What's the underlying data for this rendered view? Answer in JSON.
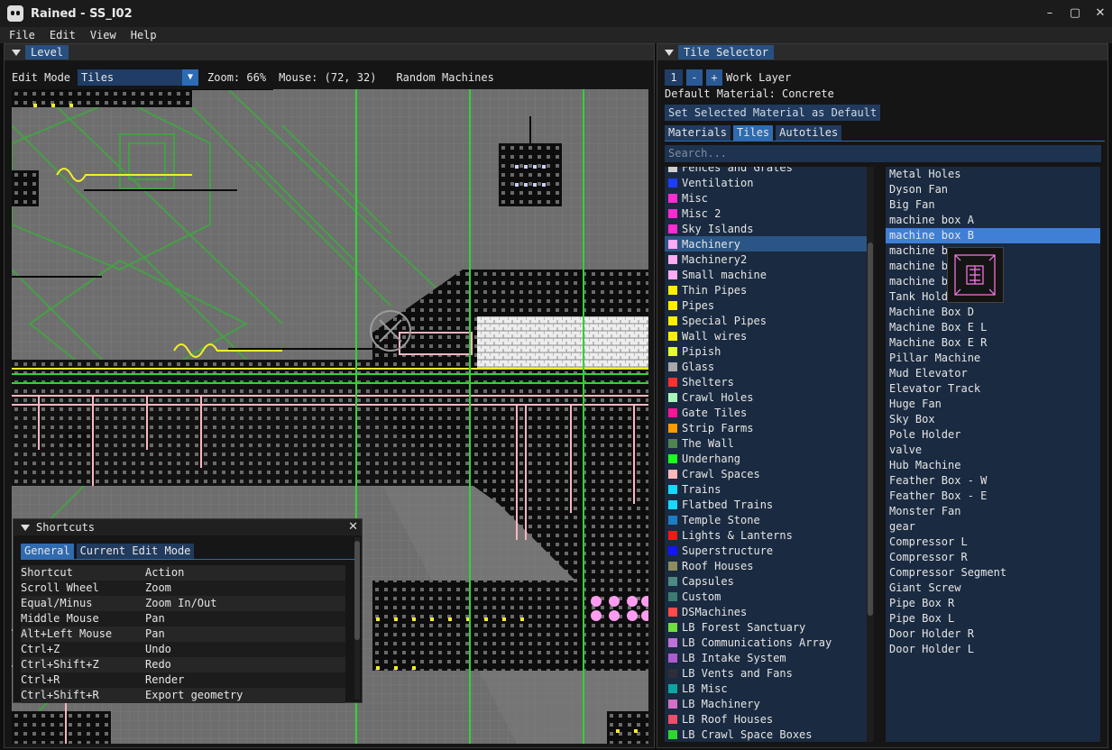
{
  "window": {
    "title": "Rained - SS_I02",
    "controls": [
      "–",
      "▢",
      "✕"
    ]
  },
  "menu": [
    "File",
    "Edit",
    "View",
    "Help"
  ],
  "level": {
    "tab": "Level",
    "edit_mode_label": "Edit Mode",
    "edit_mode_value": "Tiles",
    "zoom": "Zoom: 66%",
    "mouse": "Mouse: (72, 32)",
    "selected_tile_name": "Random Machines"
  },
  "shortcuts": {
    "title": "Shortcuts",
    "tabs": [
      "General",
      "Current Edit Mode"
    ],
    "headers": [
      "Shortcut",
      "Action"
    ],
    "rows": [
      [
        "Scroll Wheel",
        "Zoom"
      ],
      [
        "Equal/Minus",
        "Zoom In/Out"
      ],
      [
        "Middle Mouse",
        "Pan"
      ],
      [
        "Alt+Left Mouse",
        "Pan"
      ],
      [
        "Ctrl+Z",
        "Undo"
      ],
      [
        "Ctrl+Shift+Z",
        "Redo"
      ],
      [
        "Ctrl+R",
        "Render"
      ],
      [
        "Ctrl+Shift+R",
        "Export geometry"
      ]
    ]
  },
  "tile_selector": {
    "tab": "Tile Selector",
    "work_layer_value": "1",
    "minus": "-",
    "plus": "+",
    "work_layer_label": "Work Layer",
    "default_material": "Default Material: Concrete",
    "set_default_button": "Set Selected Material as Default",
    "tabs": [
      "Materials",
      "Tiles",
      "Autotiles"
    ],
    "active_tab": "Tiles",
    "search_placeholder": "Search...",
    "categories": [
      {
        "name": "Fences and Grates",
        "color": "#cfcfcf"
      },
      {
        "name": "Ventilation",
        "color": "#1e3cff"
      },
      {
        "name": "Misc",
        "color": "#ff2bd1"
      },
      {
        "name": "Misc 2",
        "color": "#ff2bd1"
      },
      {
        "name": "Sky Islands",
        "color": "#ff2bd1"
      },
      {
        "name": "Machinery",
        "color": "#ffaaf2"
      },
      {
        "name": "Machinery2",
        "color": "#ffaaf2"
      },
      {
        "name": "Small machine",
        "color": "#ffaaf2"
      },
      {
        "name": "Thin Pipes",
        "color": "#ffee00"
      },
      {
        "name": "Pipes",
        "color": "#ffee00"
      },
      {
        "name": "Special Pipes",
        "color": "#ffee00"
      },
      {
        "name": "Wall wires",
        "color": "#ffee00"
      },
      {
        "name": "Pipish",
        "color": "#e6ff2a"
      },
      {
        "name": "Glass",
        "color": "#a8a8a8"
      },
      {
        "name": "Shelters",
        "color": "#ff3030"
      },
      {
        "name": "Crawl Holes",
        "color": "#aaf5b8"
      },
      {
        "name": "Gate Tiles",
        "color": "#ff1493"
      },
      {
        "name": "Strip Farms",
        "color": "#ff9a00"
      },
      {
        "name": "The Wall",
        "color": "#4e8450"
      },
      {
        "name": "Underhang",
        "color": "#1cff1c"
      },
      {
        "name": "Crawl Spaces",
        "color": "#ffb8b8"
      },
      {
        "name": "Trains",
        "color": "#17d8ff"
      },
      {
        "name": "Flatbed Trains",
        "color": "#17d8ff"
      },
      {
        "name": "Temple Stone",
        "color": "#1d7cc4"
      },
      {
        "name": "Lights & Lanterns",
        "color": "#ff1414"
      },
      {
        "name": "Superstructure",
        "color": "#1414ff"
      },
      {
        "name": "Roof Houses",
        "color": "#8c8c5e"
      },
      {
        "name": "Capsules",
        "color": "#4e8a82"
      },
      {
        "name": "Custom",
        "color": "#3d7a72"
      },
      {
        "name": "DSMachines",
        "color": "#ff4a4a"
      },
      {
        "name": "LB Forest Sanctuary",
        "color": "#6de03a"
      },
      {
        "name": "LB Communications Array",
        "color": "#c070d8"
      },
      {
        "name": "LB Intake System",
        "color": "#b05ad0"
      },
      {
        "name": "LB Vents and Fans",
        "color": "#2e2e38"
      },
      {
        "name": "LB Misc",
        "color": "#0ea5a0"
      },
      {
        "name": "LB Machinery",
        "color": "#d46fc4"
      },
      {
        "name": "LB Roof Houses",
        "color": "#f04c6c"
      },
      {
        "name": "LB Crawl Space Boxes",
        "color": "#2ed62e"
      }
    ],
    "selected_category": "Machinery",
    "tiles": [
      "Metal Holes",
      "Dyson Fan",
      "Big Fan",
      "machine box A",
      "machine box B",
      "machine b",
      "machine b",
      "machine b",
      "Tank Hold",
      "Machine Box D",
      "Machine Box E L",
      "Machine Box E R",
      "Pillar Machine",
      "Mud Elevator",
      "Elevator Track",
      "Huge Fan",
      "Sky Box",
      "Pole Holder",
      "valve",
      "Hub Machine",
      "Feather Box - W",
      "Feather Box - E",
      "Monster Fan",
      "gear",
      "Compressor L",
      "Compressor R",
      "Compressor Segment",
      "Giant Screw",
      "Pipe Box R",
      "Pipe Box L",
      "Door Holder R",
      "Door Holder L"
    ],
    "selected_tile": "machine box B"
  },
  "colors": {
    "accent": "#2f6bb0",
    "grid_line": "#34d134",
    "tile_green": "#3fa93f",
    "wall_yellow": "#f2ef2a",
    "pink_tiles": "#ff9cf0"
  }
}
